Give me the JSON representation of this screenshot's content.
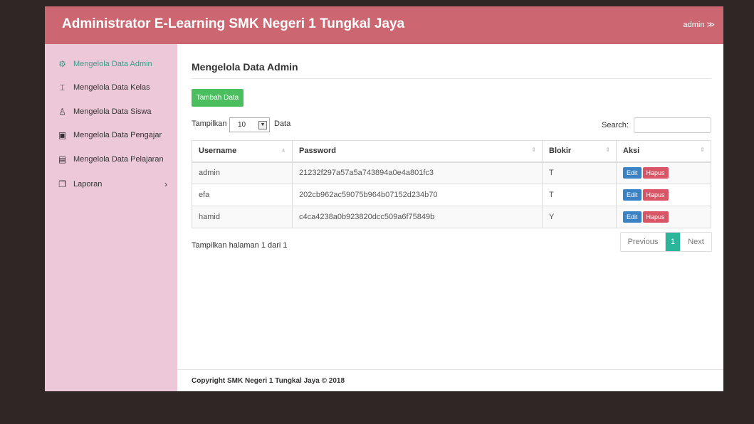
{
  "header": {
    "title": "Administrator E-Learning SMK Negeri 1 Tungkal Jaya",
    "user": "admin",
    "user_caret": "≫"
  },
  "sidebar": {
    "items": [
      {
        "label": "Mengelola Data Admin",
        "icon": "gear-icon",
        "glyph": "⚙",
        "active": true
      },
      {
        "label": "Mengelola Data Kelas",
        "icon": "class-board-icon",
        "glyph": "⌶",
        "active": false
      },
      {
        "label": "Mengelola Data Siswa",
        "icon": "user-icon",
        "glyph": "♙",
        "active": false
      },
      {
        "label": "Mengelola Data Pengajar",
        "icon": "id-card-icon",
        "glyph": "▣",
        "active": false
      },
      {
        "label": "Mengelola Data Pelajaran",
        "icon": "book-icon",
        "glyph": "▤",
        "active": false
      },
      {
        "label": "Laporan",
        "icon": "report-icon",
        "glyph": "❐",
        "active": false,
        "chevron": "›"
      }
    ]
  },
  "main": {
    "title": "Mengelola Data Admin",
    "add_button": "Tambah Data",
    "length": {
      "prefix": "Tampilkan",
      "value": "10",
      "suffix": "Data",
      "arrow": "▼"
    },
    "search_label": "Search:",
    "search_value": "",
    "table": {
      "headers": [
        "Username",
        "Password",
        "Blokir",
        "Aksi"
      ],
      "sort_indicators": [
        "▲",
        "⇕",
        "⇕",
        "⇕"
      ],
      "rows": [
        {
          "username": "admin",
          "password": "21232f297a57a5a743894a0e4a801fc3",
          "blokir": "T"
        },
        {
          "username": "efa",
          "password": "202cb962ac59075b964b07152d234b70",
          "blokir": "T"
        },
        {
          "username": "hamid",
          "password": "c4ca4238a0b923820dcc509a6f75849b",
          "blokir": "Y"
        }
      ],
      "edit_label": "Edit",
      "delete_label": "Hapus"
    },
    "info": "Tampilkan halaman 1 dari 1",
    "pagination": {
      "previous": "Previous",
      "current": "1",
      "next": "Next"
    }
  },
  "footer": {
    "text": "Copyright SMK Negeri 1 Tungkal Jaya © 2018"
  },
  "colors": {
    "header_bg": "#cc6670",
    "sidebar_bg": "#ecc8d8",
    "active_link": "#3d9d8a",
    "add_button": "#4bbf5f",
    "edit_button": "#3b82c4",
    "delete_button": "#d95565",
    "current_page": "#2bb59a",
    "page_background": "#2f2626"
  }
}
